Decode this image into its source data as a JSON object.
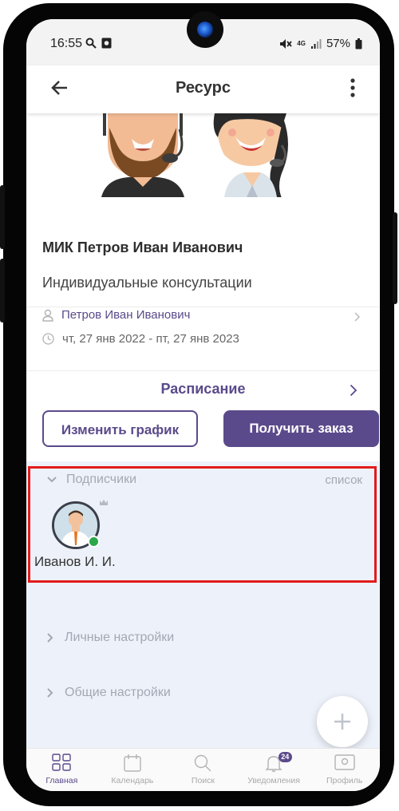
{
  "status_bar": {
    "time": "16:55",
    "network": "4G",
    "battery": "57%"
  },
  "app_bar": {
    "title": "Ресурс",
    "back_icon": "arrow-left-icon",
    "menu_icon": "more-vertical-icon"
  },
  "resource": {
    "title": "МИК Петров Иван Иванович",
    "subtitle": "Индивидуальные консультации",
    "owner": "Петров Иван Иванович",
    "period": "чт, 27 янв 2022 - пт, 27 янв 2023"
  },
  "schedule": {
    "label": "Расписание"
  },
  "actions": {
    "change_schedule": "Изменить график",
    "get_order": "Получить заказ"
  },
  "subscribers": {
    "title": "Подписчики",
    "view_mode": "список",
    "items": [
      {
        "name": "Иванов И. И.",
        "status": "online"
      }
    ]
  },
  "sections": {
    "personal_settings": "Личные настройки",
    "general_settings": "Общие настройки"
  },
  "bottom_nav": {
    "items": [
      {
        "label": "Главная",
        "icon": "grid-icon",
        "active": true
      },
      {
        "label": "Календарь",
        "icon": "calendar-icon"
      },
      {
        "label": "Поиск",
        "icon": "search-icon"
      },
      {
        "label": "Уведомления",
        "icon": "bell-icon",
        "badge": "24"
      },
      {
        "label": "Профиль",
        "icon": "profile-card-icon"
      }
    ]
  },
  "colors": {
    "accent": "#5b4a8b",
    "highlight_border": "#e21b1b",
    "online": "#2aa84a",
    "section_bg": "#edf1f9"
  }
}
